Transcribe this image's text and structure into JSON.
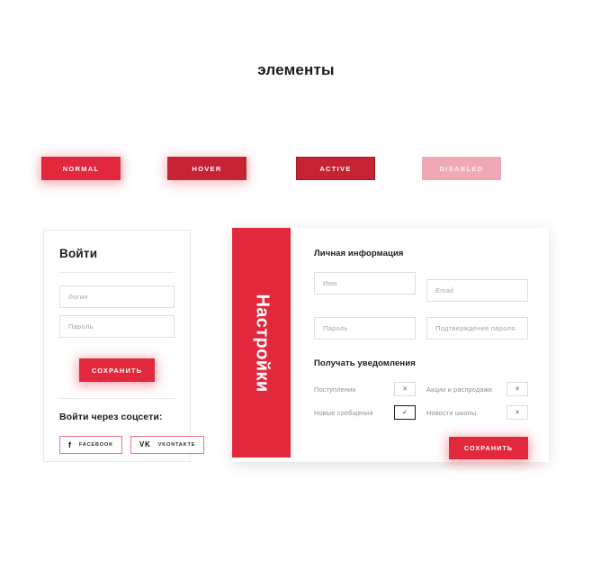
{
  "page": {
    "title": "элементы"
  },
  "buttons": [
    {
      "label": "NORMAL",
      "state": "normal",
      "color": "#E2283C"
    },
    {
      "label": "HOVER",
      "state": "hover",
      "color": "#C62434"
    },
    {
      "label": "ACTIVE",
      "state": "active",
      "color": "#C62434"
    },
    {
      "label": "DISABLED",
      "state": "disabled",
      "color": "#F0A9B2"
    }
  ],
  "login_card": {
    "title": "Войти",
    "fields": [
      {
        "placeholder": "Логин"
      },
      {
        "placeholder": "Пароль"
      }
    ],
    "save_label": "СОХРАНИТЬ",
    "social_label": "Войти через соцсети:",
    "social_buttons": [
      {
        "label": "FACEBOOK",
        "icon": "facebook-icon",
        "glyph": "f"
      },
      {
        "label": "VKONTAKTE",
        "icon": "vkontakte-icon",
        "glyph": "VK"
      }
    ]
  },
  "settings_card": {
    "side_title": "Настройки",
    "personal_section_title": "Личная информация",
    "personal_fields": [
      {
        "placeholder": "Имя"
      },
      {
        "placeholder": "Email"
      },
      {
        "placeholder": "Пароль"
      },
      {
        "placeholder": "Подтверждение пароля"
      }
    ],
    "notifications_title": "Получать уведомления",
    "notifications": [
      {
        "label": "Поступления",
        "checked": false,
        "mark": "✕"
      },
      {
        "label": "Акции и распродажи",
        "checked": false,
        "mark": "✕"
      },
      {
        "label": "Новые сообщения",
        "checked": true,
        "mark": "✓"
      },
      {
        "label": "Новости школы",
        "checked": false,
        "mark": "✕"
      }
    ],
    "save_label": "СОХРАНИТЬ"
  },
  "colors": {
    "accent": "#E2283C",
    "accent_dark": "#C62434",
    "accent_disabled": "#F0A9B2",
    "text": "#1B1B1B",
    "muted": "#8D8D8D",
    "border": "#DEDEDE"
  }
}
